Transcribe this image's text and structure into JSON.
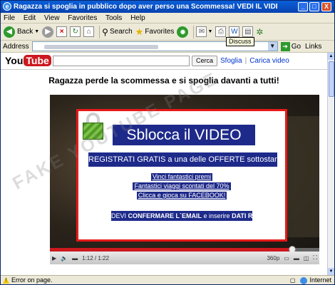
{
  "window": {
    "title": "Ragazza si spoglia in pubblico dopo aver perso una Scommessa! VEDI IL VIDEO - Microsoft Internet Explorer",
    "minimize": "_",
    "maximize": "□",
    "close": "X"
  },
  "menu": [
    "File",
    "Edit",
    "View",
    "Favorites",
    "Tools",
    "Help"
  ],
  "toolbar": {
    "back": "Back",
    "search": "Search",
    "favorites": "Favorites",
    "tooltip": "Discuss"
  },
  "address": {
    "label": "Address",
    "go": "Go",
    "links": "Links"
  },
  "youtube": {
    "logo_you": "You",
    "logo_tube": "Tube",
    "search_button": "Cerca",
    "links": [
      "Sfoglia",
      "Carica video"
    ]
  },
  "page": {
    "headline": "Ragazza perde la scommessa e si spoglia davanti a tutti!"
  },
  "overlay": {
    "title": "Sblocca il VIDEO",
    "register": "REGISTRATI GRATIS a una delle OFFERTE sottostanti",
    "offers": [
      "Vinci fantastici premi",
      "Fantastici viaggi scontati del 70%",
      "Clicca e gioca su FACEBOOK!"
    ],
    "notice_prefix": "DEVI",
    "notice_bold1": "CONFERMARE L`EMAIL",
    "notice_mid": "e inserire",
    "notice_bold2": "DATI REALI"
  },
  "player": {
    "time": "1:12 / 1:22",
    "quality": "360p",
    "progress": 0.9
  },
  "watermark": "FAKE YOUTUBE PAGE",
  "status": {
    "left": "Error on page.",
    "zone": "Internet"
  },
  "colors": {
    "overlay_bg": "#1e2a8a",
    "border_red": "#e81818",
    "youtube_red": "#cc181e"
  }
}
